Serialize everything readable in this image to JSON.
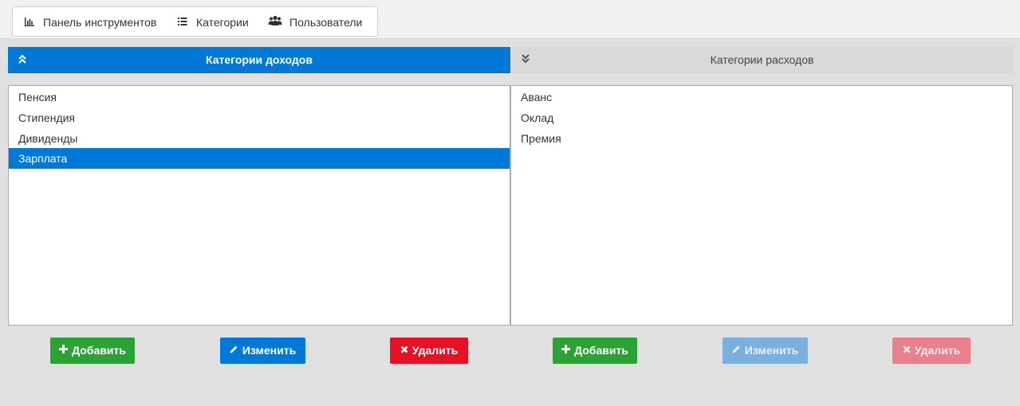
{
  "nav": {
    "items": [
      {
        "label": "Панель инструментов",
        "icon": "bar-chart-icon"
      },
      {
        "label": "Категории",
        "icon": "list-icon"
      },
      {
        "label": "Пользователи",
        "icon": "users-icon"
      }
    ]
  },
  "tabs": {
    "income": {
      "label": "Категории доходов",
      "icon": "chevron-double-up-icon",
      "active": true
    },
    "expense": {
      "label": "Категории расходов",
      "icon": "chevron-double-down-icon",
      "active": false
    }
  },
  "income_list": {
    "items": [
      "Пенсия",
      "Стипендия",
      "Дивиденды",
      "Зарплата"
    ],
    "selected": "Зарплата"
  },
  "expense_list": {
    "items": [
      "Аванс",
      "Оклад",
      "Премия"
    ]
  },
  "income_buttons": {
    "add": "Добавить",
    "edit": "Изменить",
    "delete": "Удалить"
  },
  "expense_buttons": {
    "add": "Добавить",
    "edit": "Изменить",
    "delete": "Удалить",
    "edit_enabled": false,
    "delete_enabled": false
  },
  "colors": {
    "accent": "#0078d7",
    "add": "#2aa234",
    "delete": "#e81123",
    "background": "#e0e0e0"
  }
}
